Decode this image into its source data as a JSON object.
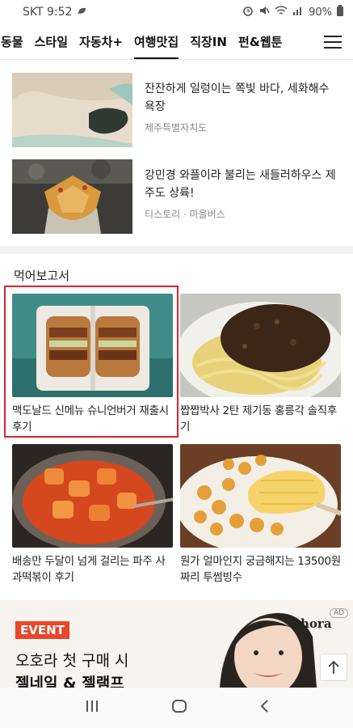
{
  "status_bar": {
    "carrier_time": "SKT 9:52",
    "battery": "90%"
  },
  "nav": {
    "tabs": [
      {
        "label": "동물"
      },
      {
        "label": "스타일"
      },
      {
        "label": "자동차+"
      },
      {
        "label": "여행맛집"
      },
      {
        "label": "직장IN"
      },
      {
        "label": "펀&웹툰"
      }
    ],
    "active_index": 3
  },
  "articles": [
    {
      "title": "잔잔하게 일렁이는 쪽빛 바다, 세화해수욕장",
      "source": "제주특별자치도"
    },
    {
      "title": "강민경 와플이라 불리는 새들러하우스 제주도 상륙!",
      "source": "티스토리 · 마을버스"
    }
  ],
  "section": {
    "title": "먹어보고서",
    "cards": [
      {
        "caption": "맥도날드 신메뉴 슈니언버거 재출시 후기"
      },
      {
        "caption": "짭짭박사 2탄 제기동 홍릉각 솔직후기"
      },
      {
        "caption": "배송만 두달이 넘게 걸리는 파주 사과떡볶이 후기"
      },
      {
        "caption": "원가 얼마인지 궁금해지는 13500원짜리 투썸빙수"
      }
    ]
  },
  "ad": {
    "event_label": "EVENT",
    "line1": "오호라 첫 구매 시",
    "line2": "젤네일 & 젤램프",
    "brand": "ohora",
    "badge": "AD"
  },
  "colors": {
    "highlight": "#d8262f",
    "event": "#e8472a"
  }
}
